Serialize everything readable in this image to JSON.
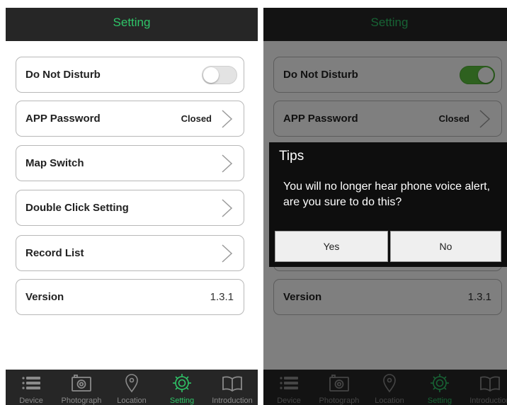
{
  "screen_before": {
    "title": "Setting",
    "rows": [
      {
        "label": "Do Not Disturb",
        "toggle_on": false
      },
      {
        "label": "APP Password",
        "value": "Closed"
      },
      {
        "label": "Map Switch"
      },
      {
        "label": "Double Click Setting"
      },
      {
        "label": "Record List"
      },
      {
        "label": "Version",
        "value": "1.3.1"
      }
    ]
  },
  "screen_after": {
    "title": "Setting",
    "rows": [
      {
        "label": "Do Not Disturb",
        "toggle_on": true
      },
      {
        "label": "APP Password",
        "value": "Closed"
      },
      {
        "label": "Version",
        "value": "1.3.1"
      }
    ],
    "dialog": {
      "title": "Tips",
      "message": "You will no longer hear phone voice alert, are you sure to do this?",
      "yes_label": "Yes",
      "no_label": "No"
    }
  },
  "tabbar": {
    "tabs": [
      {
        "label": "Device",
        "icon": "list-icon"
      },
      {
        "label": "Photograph",
        "icon": "camera-icon"
      },
      {
        "label": "Location",
        "icon": "location-pin-icon"
      },
      {
        "label": "Setting",
        "icon": "gear-icon",
        "active": true
      },
      {
        "label": "Introduction",
        "icon": "book-icon"
      }
    ]
  },
  "colors": {
    "accent": "#2fc468",
    "toggle_on": "#5cc23f",
    "bar_background": "#262626"
  }
}
